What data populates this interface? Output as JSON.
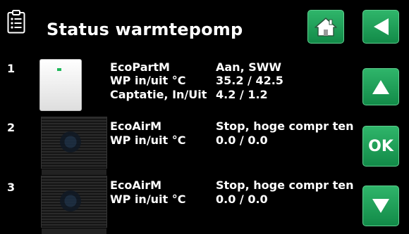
{
  "header": {
    "title": "Status warmtepomp",
    "title_icon": "clipboard-list-icon"
  },
  "nav": {
    "home_icon": "home-icon",
    "back_icon": "back-arrow-icon",
    "up_icon": "up-arrow-icon",
    "ok_label": "OK",
    "down_icon": "down-arrow-icon"
  },
  "units": [
    {
      "index": "1",
      "name": "EcoPartM",
      "status": "Aan, SWW",
      "wp_label": "WP in/uit °C",
      "wp_value": "35.2 / 42.5",
      "captatie_label": "Captatie, In/Uit",
      "captatie_value": "4.2 / 1.2"
    },
    {
      "index": "2",
      "name": "EcoAirM",
      "status": "Stop, hoge compr ten",
      "wp_label": "WP in/uit °C",
      "wp_value": "0.0 / 0.0"
    },
    {
      "index": "3",
      "name": "EcoAirM",
      "status": "Stop, hoge compr ten",
      "wp_label": "WP in/uit °C",
      "wp_value": "0.0 / 0.0"
    }
  ],
  "colors": {
    "background": "#000000",
    "button_green": "#1e9e57",
    "text": "#ffffff"
  }
}
